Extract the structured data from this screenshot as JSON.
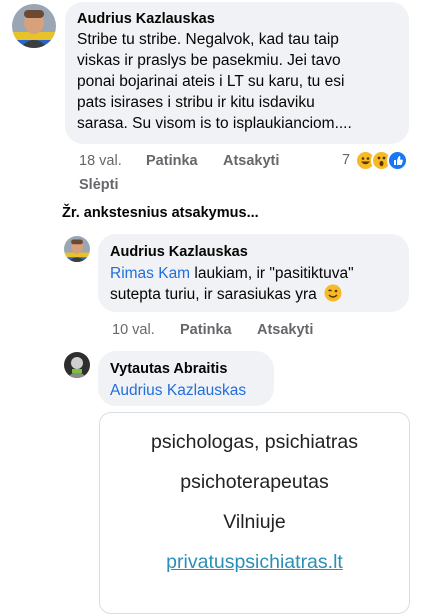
{
  "comment1": {
    "author": "Audrius Kazlauskas",
    "lines": [
      "Stribe tu stribe. Negalvok, kad tau taip",
      "viskas ir praslys be pasekmiu. Jei tavo",
      "ponai bojarinai ateis i LT su karu, tu esi",
      "pats isirases i stribu ir kitu isdaviku",
      "sarasa. Su visom is to isplaukianciom...."
    ],
    "time": "18 val.",
    "like_label": "Patinka",
    "reply_label": "Atsakyti",
    "reaction_count": "7",
    "reactions": [
      "laugh-react-icon",
      "wow-react-icon",
      "like-react-icon"
    ],
    "hide_label": "Slėpti"
  },
  "previous_replies": "Žr. ankstesnius atsakymus...",
  "reply1": {
    "author": "Audrius Kazlauskas",
    "mention": "Rimas Kam",
    "line1_rest": " laukiam, ir \"pasitiktuva\"",
    "line2": "sutepta turiu, ir sarasiukas yra",
    "emoji": "wink-emoji-icon",
    "time": "10 val.",
    "like_label": "Patinka",
    "reply_label": "Atsakyti"
  },
  "reply2": {
    "author": "Vytautas Abraitis",
    "mention": "Audrius Kazlauskas",
    "ad": {
      "line1": "psichologas, psichiatras",
      "line2": "psichoterapeutas",
      "line3": "Vilniuje",
      "link": "privatuspsichiatras.lt"
    }
  },
  "colors": {
    "bubble": "#f0f2f5",
    "mention": "#216fdb",
    "meta": "#65676b",
    "link": "#2a8fb8"
  }
}
